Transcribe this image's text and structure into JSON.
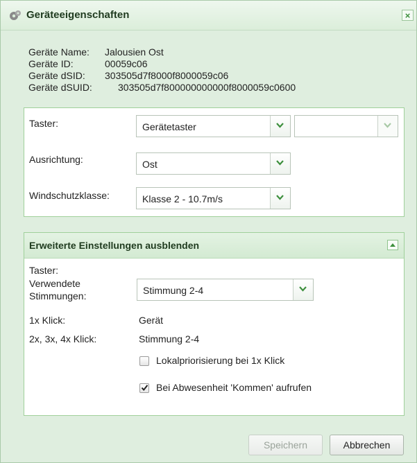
{
  "dialog": {
    "title": "Geräteeigenschaften",
    "close_label": "×"
  },
  "device_info": {
    "name_label": "Geräte Name:",
    "name_value": "Jalousien Ost",
    "id_label": "Geräte ID:",
    "id_value": "00059c06",
    "dsid_label": "Geräte dSID:",
    "dsid_value": "303505d7f8000f8000059c06",
    "dsuid_label": "Geräte dSUID:",
    "dsuid_value": "303505d7f800000000000f8000059c0600"
  },
  "basic_settings": {
    "taster_label": "Taster:",
    "taster_value": "Gerätetaster",
    "taster_secondary_value": "",
    "ausrichtung_label": "Ausrichtung:",
    "ausrichtung_value": "Ost",
    "windschutz_label": "Windschutzklasse:",
    "windschutz_value": "Klasse 2 - 10.7m/s"
  },
  "advanced_settings": {
    "header": "Erweiterte Einstellungen ausblenden",
    "taster_label": "Taster:",
    "stimmungen_label_line1": "Verwendete",
    "stimmungen_label_line2": "Stimmungen:",
    "stimmungen_value": "Stimmung 2-4",
    "click1_label": "1x Klick:",
    "click1_value": "Gerät",
    "click234_label": "2x, 3x, 4x Klick:",
    "click234_value": "Stimmung 2-4",
    "lokalpriorisierung_label": "Lokalpriorisierung bei 1x Klick",
    "lokalpriorisierung_checked": false,
    "abwesenheit_label": "Bei Abwesenheit 'Kommen' aufrufen",
    "abwesenheit_checked": true
  },
  "footer": {
    "save_label": "Speichern",
    "cancel_label": "Abbrechen"
  },
  "colors": {
    "accent_green": "#3d8f3d",
    "panel_border": "#9fd09a",
    "dialog_background": "#dfeedf"
  }
}
